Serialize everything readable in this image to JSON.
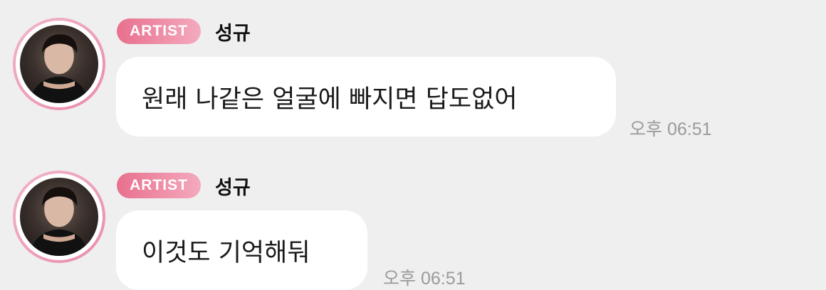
{
  "messages": [
    {
      "badge": "ARTIST",
      "sender": "성규",
      "text": "원래 나같은 얼굴에 빠지면 답도없어",
      "time": "오후 06:51"
    },
    {
      "badge": "ARTIST",
      "sender": "성규",
      "text": "이것도 기억해둬",
      "time": "오후 06:51"
    }
  ],
  "colors": {
    "background": "#efefef",
    "bubble": "#ffffff",
    "badge_start": "#e8708f",
    "badge_end": "#f4aabd",
    "avatar_ring": "#e98bab",
    "time_text": "#9a9a9a"
  }
}
